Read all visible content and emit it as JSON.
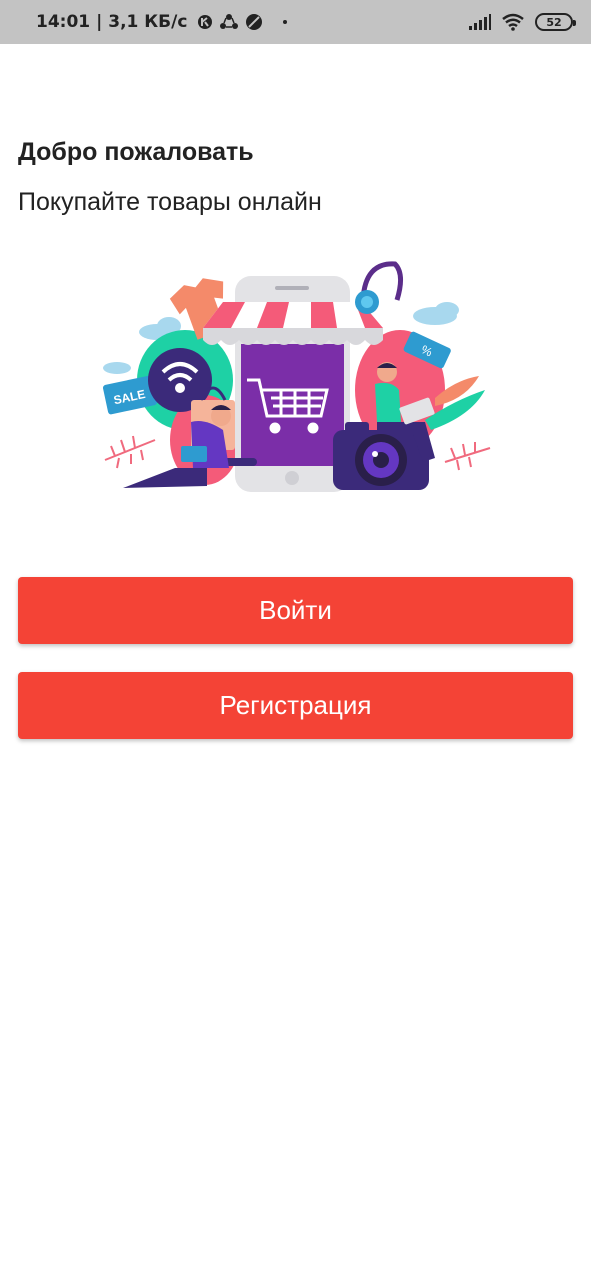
{
  "status_bar": {
    "time": "14:01",
    "network_speed": "| 3,1 КБ/с",
    "battery_level": "52",
    "icons": [
      "app-notification-icon",
      "sync-icon",
      "compass-icon",
      "signal-icon",
      "wifi-icon",
      "battery-icon"
    ]
  },
  "welcome": {
    "title": "Добро пожаловать",
    "subtitle": "Покупайте товары онлайн"
  },
  "illustration": {
    "sale_tag": "SALE",
    "percent_tag": "%"
  },
  "buttons": {
    "login_label": "Войти",
    "register_label": "Регистрация"
  },
  "colors": {
    "accent": "#f44336",
    "status_bar": "#c3c3c3",
    "text": "#222222"
  }
}
